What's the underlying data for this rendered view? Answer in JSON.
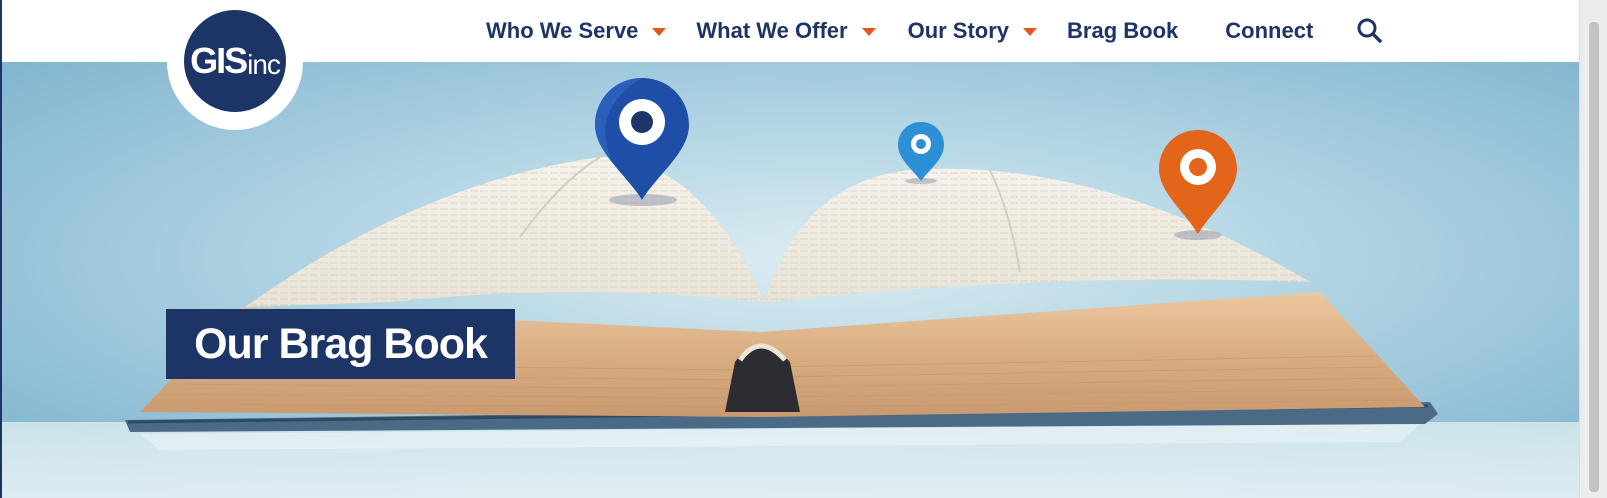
{
  "brand": {
    "logo_text": "GIS",
    "logo_suffix": "inc"
  },
  "nav": {
    "items": [
      {
        "label": "Who We Serve",
        "has_dropdown": true
      },
      {
        "label": "What We Offer",
        "has_dropdown": true
      },
      {
        "label": "Our Story",
        "has_dropdown": true
      },
      {
        "label": "Brag Book",
        "has_dropdown": false
      },
      {
        "label": "Connect",
        "has_dropdown": false
      }
    ],
    "search_icon": "search-icon"
  },
  "hero": {
    "title": "Our Brag Book",
    "pins": [
      {
        "color": "#1e4ea8",
        "icon": "map-pin-icon"
      },
      {
        "color": "#2d8fd6",
        "icon": "map-pin-icon"
      },
      {
        "color": "#e2651a",
        "icon": "map-pin-icon"
      }
    ]
  },
  "colors": {
    "brand_navy": "#1d3466",
    "accent_orange": "#e2571d",
    "hero_blue": "#8fc1d8"
  }
}
